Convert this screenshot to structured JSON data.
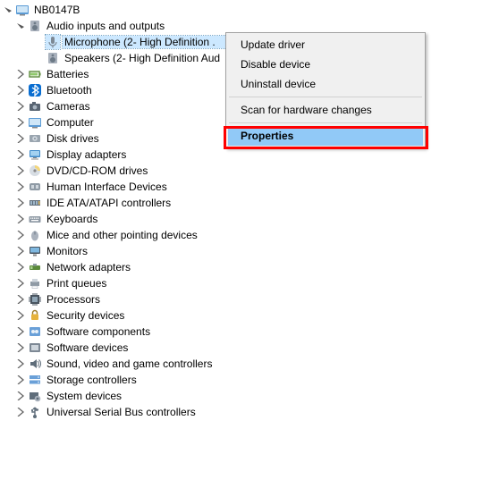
{
  "root": {
    "label": "NB0147B"
  },
  "audio": {
    "label": "Audio inputs and outputs",
    "mic": "Microphone (2- High Definition .",
    "speakers": "Speakers (2- High Definition Aud"
  },
  "nodes": [
    {
      "id": "batteries",
      "label": "Batteries",
      "icon": "battery"
    },
    {
      "id": "bluetooth",
      "label": "Bluetooth",
      "icon": "bluetooth"
    },
    {
      "id": "cameras",
      "label": "Cameras",
      "icon": "camera"
    },
    {
      "id": "computer",
      "label": "Computer",
      "icon": "computer"
    },
    {
      "id": "disk-drives",
      "label": "Disk drives",
      "icon": "disk"
    },
    {
      "id": "display-adapters",
      "label": "Display adapters",
      "icon": "display"
    },
    {
      "id": "dvd-cd-rom",
      "label": "DVD/CD-ROM drives",
      "icon": "cd"
    },
    {
      "id": "hid",
      "label": "Human Interface Devices",
      "icon": "hid"
    },
    {
      "id": "ide-ata",
      "label": "IDE ATA/ATAPI controllers",
      "icon": "ide"
    },
    {
      "id": "keyboards",
      "label": "Keyboards",
      "icon": "keyboard"
    },
    {
      "id": "mice",
      "label": "Mice and other pointing devices",
      "icon": "mouse"
    },
    {
      "id": "monitors",
      "label": "Monitors",
      "icon": "monitor"
    },
    {
      "id": "network-adapters",
      "label": "Network adapters",
      "icon": "network"
    },
    {
      "id": "print-queues",
      "label": "Print queues",
      "icon": "printer"
    },
    {
      "id": "processors",
      "label": "Processors",
      "icon": "cpu"
    },
    {
      "id": "security-devices",
      "label": "Security devices",
      "icon": "security"
    },
    {
      "id": "software-components",
      "label": "Software components",
      "icon": "swc"
    },
    {
      "id": "software-devices",
      "label": "Software devices",
      "icon": "swdev"
    },
    {
      "id": "sound-video-game",
      "label": "Sound, video and game controllers",
      "icon": "sound"
    },
    {
      "id": "storage-controllers",
      "label": "Storage controllers",
      "icon": "storage"
    },
    {
      "id": "system-devices",
      "label": "System devices",
      "icon": "system"
    },
    {
      "id": "usb",
      "label": "Universal Serial Bus controllers",
      "icon": "usb"
    }
  ],
  "context_menu": {
    "update": "Update driver",
    "disable": "Disable device",
    "uninstall": "Uninstall device",
    "scan": "Scan for hardware changes",
    "properties": "Properties"
  }
}
